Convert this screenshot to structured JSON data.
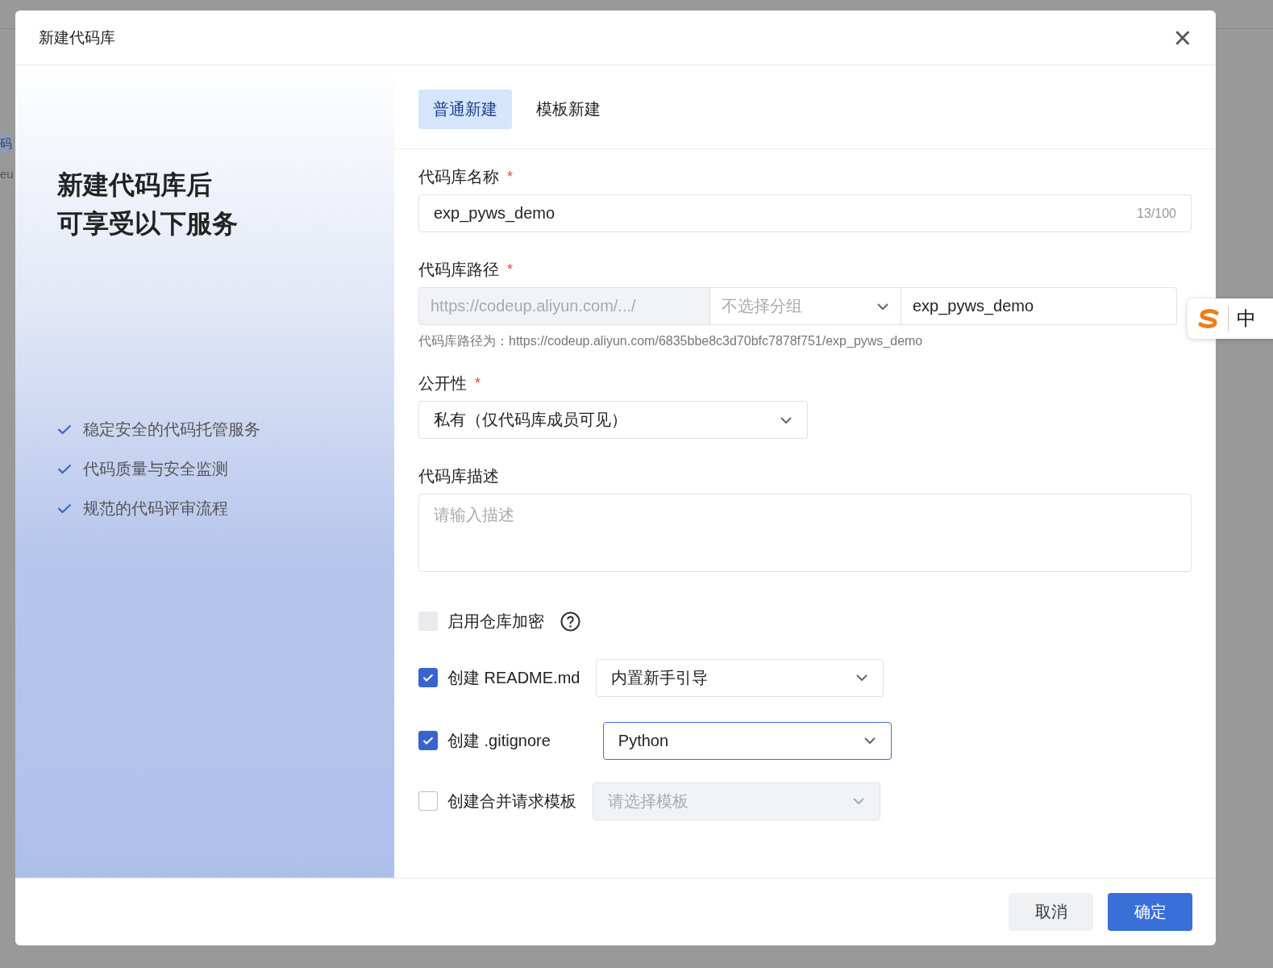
{
  "background_page": {
    "items": [
      {
        "label": "码",
        "selected": true
      },
      {
        "label": "eu",
        "selected": false
      }
    ]
  },
  "dialog": {
    "title": "新建代码库",
    "close": "×"
  },
  "intro": {
    "heading_lines": [
      "新建代码库后",
      "可享受以下服务"
    ],
    "features": [
      "稳定安全的代码托管服务",
      "代码质量与安全监测",
      "规范的代码评审流程"
    ]
  },
  "tabs": [
    {
      "label": "普通新建",
      "selected": true
    },
    {
      "label": "模板新建",
      "selected": false
    }
  ],
  "name_field": {
    "label": "代码库名称",
    "required_mark": "*",
    "value": "exp_pyws_demo",
    "count": "13/100"
  },
  "path_field": {
    "label": "代码库路径",
    "required_mark": "*",
    "prefix": "https://codeup.aliyun.com/.../",
    "group_placeholder": "不选择分组",
    "value": "exp_pyws_demo",
    "hint": "代码库路径为：https://codeup.aliyun.com/6835bbe8c3d70bfc7878f751/exp_pyws_demo"
  },
  "visibility_field": {
    "label": "公开性",
    "required_mark": "*",
    "value": "私有（仅代码库成员可见）"
  },
  "description_field": {
    "label": "代码库描述",
    "placeholder": "请输入描述"
  },
  "options": [
    {
      "kind": "help",
      "label": "启用仓库加密",
      "checked": false,
      "disabled": true
    },
    {
      "kind": "select",
      "label": "创建 README.md",
      "checked": true,
      "disabled": false,
      "select": {
        "value": "内置新手引导",
        "focused": false,
        "disabled": false
      }
    },
    {
      "kind": "select",
      "label": "创建 .gitignore",
      "checked": true,
      "disabled": false,
      "select": {
        "value": "Python",
        "focused": true,
        "disabled": false
      }
    },
    {
      "kind": "select",
      "label": "创建合并请求模板",
      "checked": false,
      "disabled": false,
      "select": {
        "placeholder": "请选择模板",
        "focused": false,
        "disabled": true
      }
    }
  ],
  "buttons": [
    {
      "kind": "secondary",
      "label": "取消"
    },
    {
      "kind": "primary",
      "label": "确定"
    }
  ],
  "ime_toolbar": {
    "mode": "中"
  }
}
